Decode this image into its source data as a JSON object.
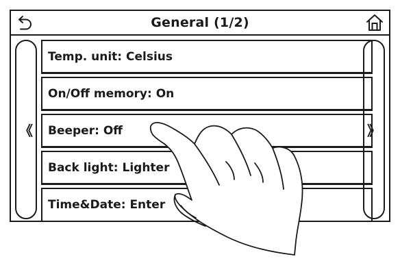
{
  "header": {
    "title": "General (1/2)",
    "back_icon": "back-arrow-icon",
    "home_icon": "home-icon"
  },
  "nav": {
    "prev_glyph": "《",
    "next_glyph": "》"
  },
  "settings": [
    {
      "label": "Temp. unit: Celsius"
    },
    {
      "label": "On/Off memory: On"
    },
    {
      "label": "Beeper: Off"
    },
    {
      "label": "Back light: Lighter"
    },
    {
      "label": "Time&Date: Enter"
    }
  ],
  "colors": {
    "line": "#1a1a1a",
    "background": "#ffffff"
  }
}
